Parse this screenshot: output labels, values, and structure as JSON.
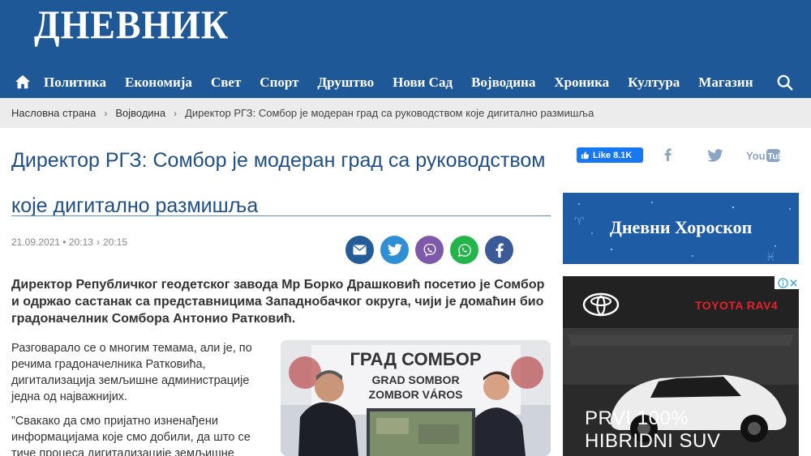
{
  "site": {
    "logo": "ДНЕВНИК"
  },
  "nav": {
    "items": [
      "Политика",
      "Економија",
      "Свет",
      "Спорт",
      "Друштво",
      "Нови Сад",
      "Војводина",
      "Хроника",
      "Култура",
      "Магазин"
    ]
  },
  "breadcrumb": {
    "home": "Насловна страна",
    "section": "Војводина",
    "current": "Директор РГЗ: Сомбор је модеран град са руководством које дигитално размишља"
  },
  "article": {
    "title": "Директор РГЗ: Сомбор је модеран град са руководством које дигитално размишља",
    "published": "21.09.2021 • 20:13",
    "updated": "20:15",
    "lead": "Директор Републичког геодетског завода Мр Борко Драшковић посетио је Сомбор и одржао састанак са представницима Западнобачког округа,  чији је домаћин био градоначелник Сомбора Антонио Ратковић.",
    "paragraphs": [
      "Разговарало се о многим темама, али је, по речима градоначелника Ратковића, дигитализација земљишне администрације једна од најважнијих.",
      "”Свакако да смо пријатно изненађени информацијама које смо добили, да што се тиче процеса дигитализације земљишне"
    ],
    "photo": {
      "banner_line1": "ГРАД СОМБОР",
      "banner_line2": "GRAD SOMBOR",
      "banner_line3": "ZOMBOR VÁROS"
    }
  },
  "sidebar": {
    "fb_like_label": "Like 8.1K",
    "horoscope": "Дневни Хороскоп",
    "ad": {
      "brand": "TOYOTA RAV4",
      "headline_line1": "PRVI 100%",
      "headline_line2": "HIBRIDNI SUV"
    }
  },
  "colors": {
    "header_bg": "#1f5897",
    "title": "#1f4f85",
    "email": "#235c98",
    "twitter": "#2f8fd4",
    "viber": "#7e59a9",
    "whatsapp": "#24b54a",
    "facebook": "#3b5a98"
  }
}
